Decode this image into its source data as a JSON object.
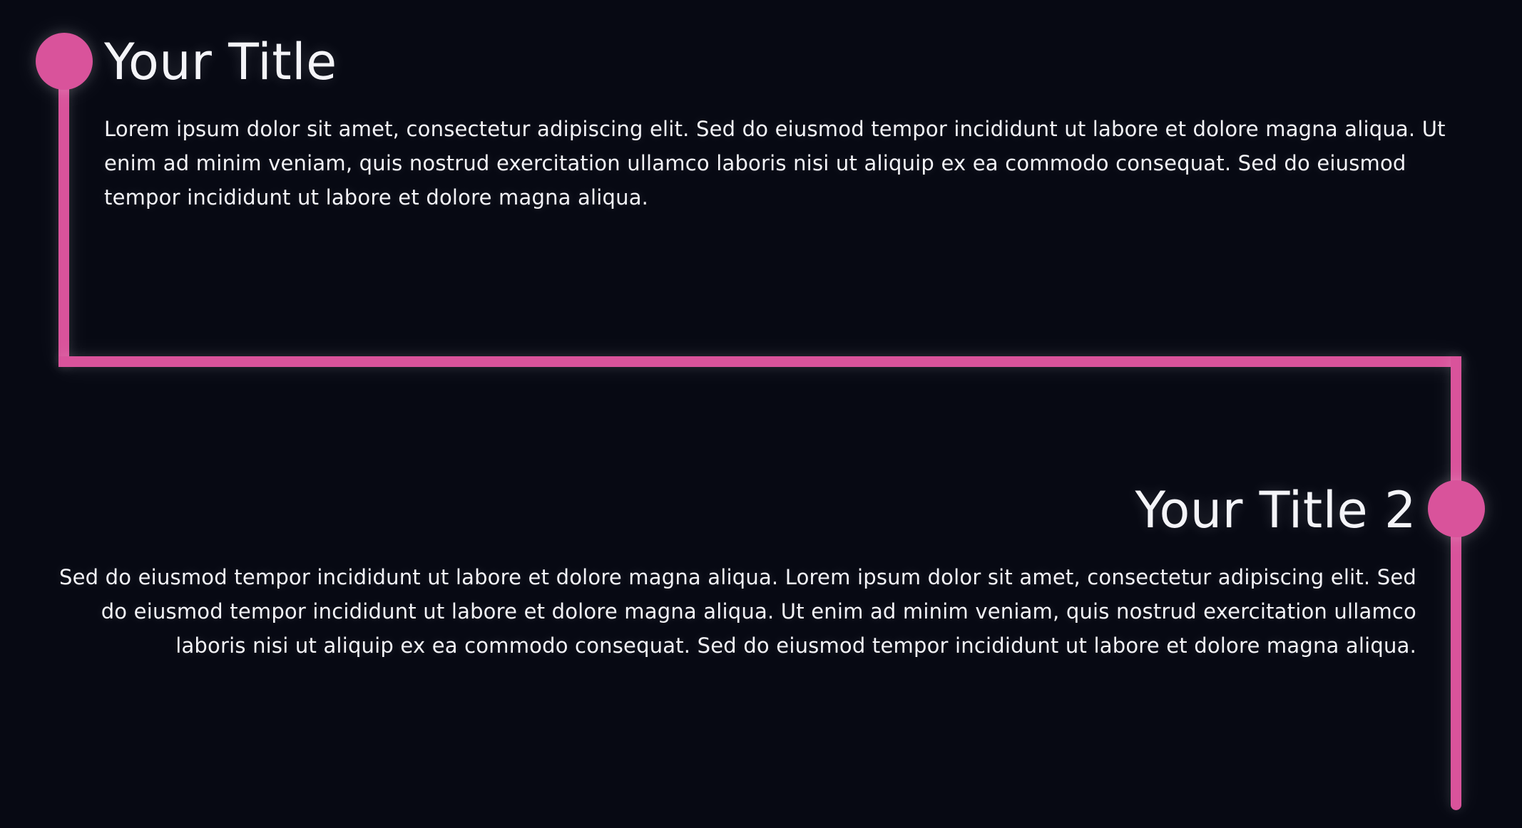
{
  "colors": {
    "background": "#070913",
    "accent": "#d9539b",
    "text": "#f4f4f8"
  },
  "items": [
    {
      "title": "Your Title",
      "body": "Lorem ipsum dolor sit amet, consectetur adipiscing elit. Sed do eiusmod tempor incididunt ut labore et dolore magna aliqua. Ut enim ad minim veniam, quis nostrud exercitation ullamco laboris nisi ut aliquip ex ea commodo consequat. Sed do eiusmod tempor incididunt ut labore et dolore magna aliqua."
    },
    {
      "title": "Your Title 2",
      "body": "Sed do eiusmod tempor incididunt ut labore et dolore magna aliqua. Lorem ipsum dolor sit amet, consectetur adipiscing elit. Sed do eiusmod tempor incididunt ut labore et dolore magna aliqua. Ut enim ad minim veniam, quis nostrud exercitation ullamco laboris nisi ut aliquip ex ea commodo consequat. Sed do eiusmod tempor incididunt ut labore et dolore magna aliqua."
    }
  ]
}
